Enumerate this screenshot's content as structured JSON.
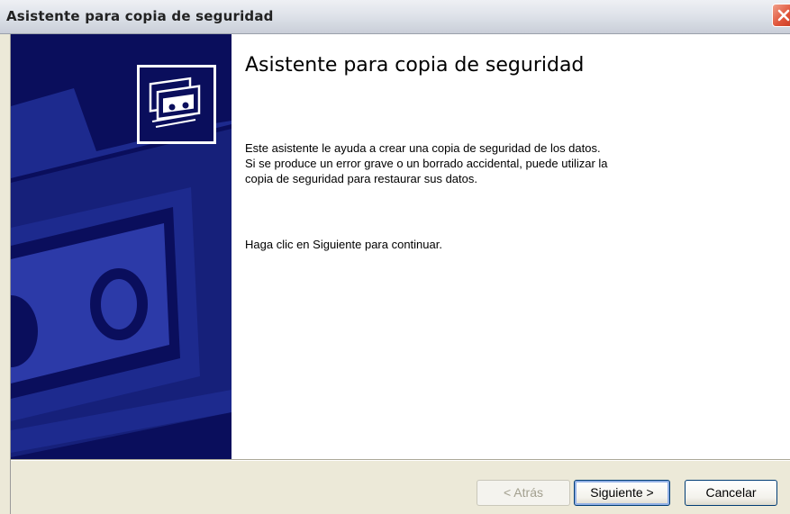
{
  "window": {
    "title": "Asistente para copia de seguridad"
  },
  "content": {
    "heading": "Asistente para copia de seguridad",
    "paragraph1_line1": "Este asistente le ayuda a crear una copia de seguridad de los datos.",
    "paragraph1_line2": "Si se produce un error grave o un borrado accidental, puede utilizar la",
    "paragraph1_line3": "copia de seguridad para restaurar sus datos.",
    "paragraph2": "Haga clic en Siguiente para continuar."
  },
  "buttons": {
    "back_label": "< Atrás",
    "next_label": "Siguiente >",
    "cancel_label": "Cancelar"
  },
  "icons": {
    "close": "close-icon",
    "wizard": "backup-tape-icon"
  },
  "colors": {
    "side_panel": "#0a0e5c",
    "close_button": "#e0553a",
    "focus_ring": "#93b1e6"
  }
}
